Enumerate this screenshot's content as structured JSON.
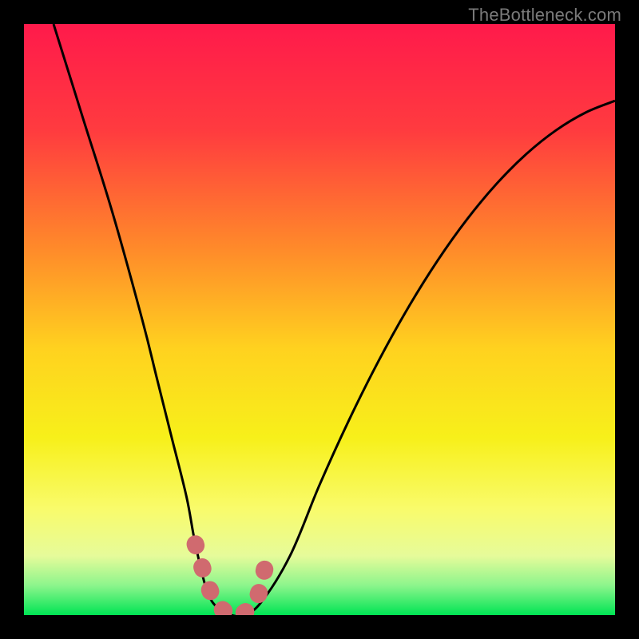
{
  "watermark": "TheBottleneck.com",
  "chart_data": {
    "type": "line",
    "title": "",
    "xlabel": "",
    "ylabel": "",
    "xlim": [
      0,
      100
    ],
    "ylim": [
      0,
      100
    ],
    "series": [
      {
        "name": "bottleneck-curve",
        "x": [
          5,
          10,
          15,
          20,
          22.5,
          25,
          27.5,
          29,
          31,
          33,
          35,
          37,
          40,
          45,
          50,
          55,
          60,
          65,
          70,
          75,
          80,
          85,
          90,
          95,
          100
        ],
        "y": [
          100,
          84,
          68,
          50,
          40,
          30,
          20,
          12,
          4,
          1,
          0,
          0,
          2,
          10,
          22,
          33,
          43,
          52,
          60,
          67,
          73,
          78,
          82,
          85,
          87
        ]
      },
      {
        "name": "optimal-zone",
        "x": [
          29,
          30.5,
          32,
          33.5,
          35,
          36.5,
          38,
          39.5,
          41
        ],
        "y": [
          12,
          7,
          3,
          1,
          0,
          0,
          1,
          3,
          9
        ]
      }
    ],
    "annotations": []
  },
  "colors": {
    "curve": "#000000",
    "highlight": "#d06a6f",
    "gradient_stops": [
      {
        "offset": 0.0,
        "color": "#ff1a4b"
      },
      {
        "offset": 0.18,
        "color": "#ff3b3f"
      },
      {
        "offset": 0.38,
        "color": "#ff8a2a"
      },
      {
        "offset": 0.55,
        "color": "#ffd21f"
      },
      {
        "offset": 0.7,
        "color": "#f7f01a"
      },
      {
        "offset": 0.82,
        "color": "#f9fb6b"
      },
      {
        "offset": 0.9,
        "color": "#e6fb9a"
      },
      {
        "offset": 0.95,
        "color": "#8cf58c"
      },
      {
        "offset": 1.0,
        "color": "#00e454"
      }
    ]
  }
}
